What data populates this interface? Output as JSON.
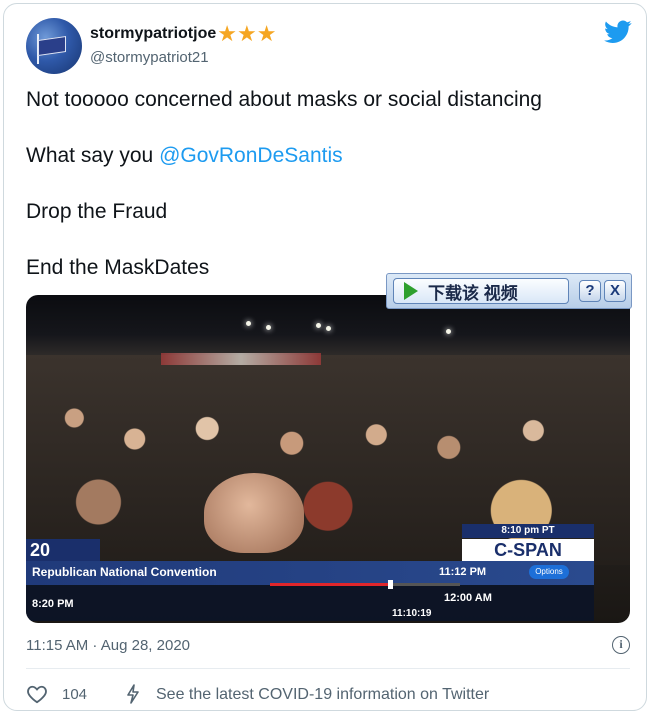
{
  "user": {
    "display_name": "stormypatriotjoe",
    "stars": "★★★",
    "handle": "@stormypatriot21"
  },
  "tweet": {
    "line1": "Not tooooo concerned about masks or social distancing",
    "line2_prefix": "What say you ",
    "line2_mention": "@GovRonDeSantis",
    "line3": "Drop the Fraud",
    "line4": "End the MaskDates"
  },
  "video": {
    "network_badge": "20",
    "cspan_time": "8:10 pm PT",
    "cspan_logo": "C-SPAN",
    "event_title": "Republican National Convention",
    "clock_top": "11:12 PM",
    "options_label": "Options",
    "clock_left": "8:20 PM",
    "clock_right": "12:00 AM",
    "clock_current": "11:10:19",
    "progress_fraction": 0.63
  },
  "download_bar": {
    "label": "下载该 视频",
    "help": "?",
    "close": "X"
  },
  "meta": {
    "timestamp": "11:15 AM · Aug 28, 2020",
    "info_glyph": "i"
  },
  "footer": {
    "like_count": "104",
    "covid_text": "See the latest COVID-19 information on Twitter"
  },
  "colors": {
    "accent": "#1d9bf0",
    "text": "#0f1419",
    "muted": "#536471",
    "star": "#f5a623"
  }
}
